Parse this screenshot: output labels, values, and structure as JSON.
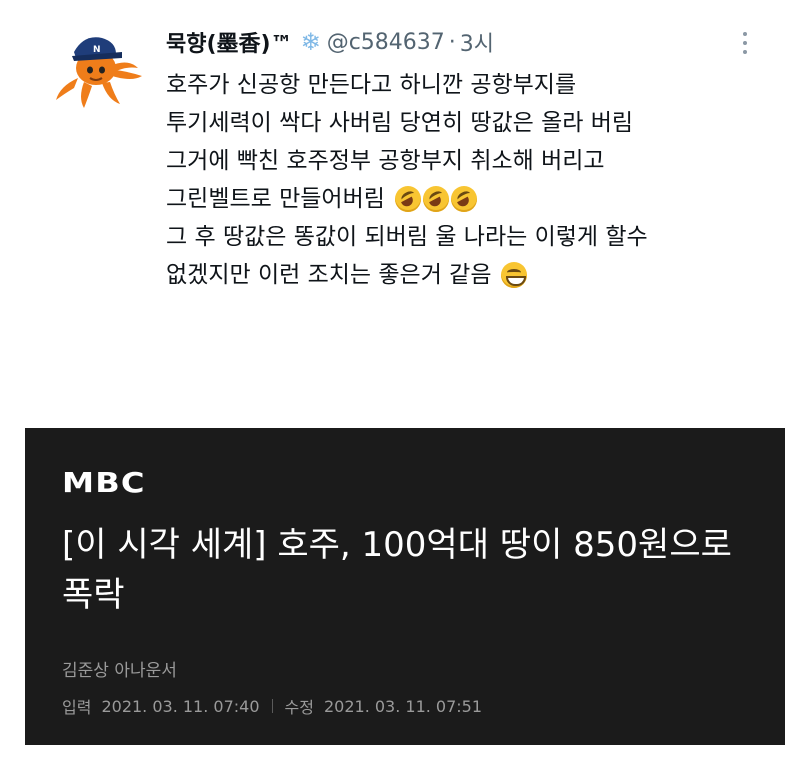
{
  "tweet": {
    "display_name": "묵향(墨香)™",
    "handle": "@c584637",
    "separator": "·",
    "time": "3시",
    "badge_icon": "snowflake-icon",
    "more_icon": "more-vertical-icon",
    "lines": [
      "호주가 신공항 만든다고 하니깐 공항부지를",
      "투기세력이 싹다 사버림 당연히 땅값은 올라 버림",
      "그거에 빡친 호주정부 공항부지 취소해 버리고",
      "그린벨트로 만들어버림",
      "그 후 땅값은 똥값이 되버림 울 나라는 이렇게 할수",
      "없겠지만 이런 조치는 좋은거 같음"
    ],
    "emoji": [
      "rolling-on-floor-laughing",
      "grinning-face"
    ]
  },
  "news": {
    "brand": "MBC",
    "headline": "[이 시각 세계] 호주, 100억대 땅이 850원으로 폭락",
    "reporter": "김준상 아나운서",
    "published_label": "입력",
    "published_time": "2021. 03. 11. 07:40",
    "modified_label": "수정",
    "modified_time": "2021. 03. 11. 07:51"
  },
  "colors": {
    "news_background": "#1b1b1b",
    "handle_gray": "#536471",
    "snowflake_blue": "#7fb8e6",
    "avatar_orange": "#ef7d1a",
    "cap_navy": "#1f3d7a"
  }
}
